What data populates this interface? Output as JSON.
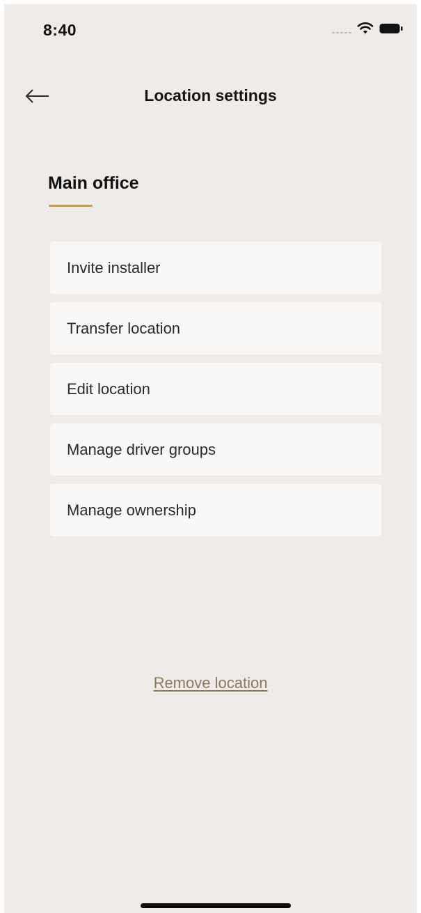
{
  "status_bar": {
    "time": "8:40",
    "icons": [
      "signal-dots-icon",
      "wifi-icon",
      "battery-icon"
    ]
  },
  "nav": {
    "back_icon": "arrow-left-icon",
    "title": "Location settings"
  },
  "section": {
    "title": "Main office",
    "underline_color": "#c2a24c"
  },
  "menu": {
    "items": [
      {
        "label": "Invite installer"
      },
      {
        "label": "Transfer location"
      },
      {
        "label": "Edit location"
      },
      {
        "label": "Manage driver groups"
      },
      {
        "label": "Manage ownership"
      }
    ]
  },
  "actions": {
    "remove_label": "Remove location",
    "remove_color": "#8a7a59"
  },
  "colors": {
    "background": "#efebe8",
    "card": "#f9f8f7",
    "accent": "#c2a24c"
  }
}
